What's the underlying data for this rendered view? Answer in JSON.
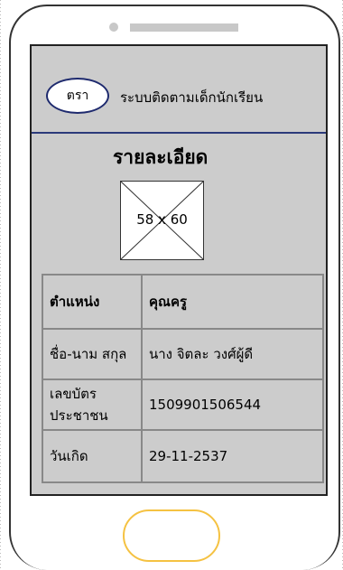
{
  "header": {
    "logo_text": "ตรา",
    "title": "ระบบติดตามเด็กนักเรียน"
  },
  "detail": {
    "heading": "รายละเอียด",
    "photo_placeholder": "58 x 60"
  },
  "table": {
    "rows": [
      {
        "label": "ตำแหน่ง",
        "value": "คุณครู"
      },
      {
        "label": "ชื่อ-นาม สกุล",
        "value": "นาง จิตละ วงศ์ผู้ดี"
      },
      {
        "label": "เลขบัตร ประชาชน",
        "value": "1509901506544"
      },
      {
        "label": "วันเกิด",
        "value": "29-11-2537"
      }
    ]
  },
  "colors": {
    "screen_bg": "#cccccc",
    "header_divider": "#2b3a7a",
    "logo_border": "#1e2a6e",
    "home_button_border": "#f5c242"
  },
  "icons": {
    "image_placeholder": "image-placeholder-icon"
  }
}
